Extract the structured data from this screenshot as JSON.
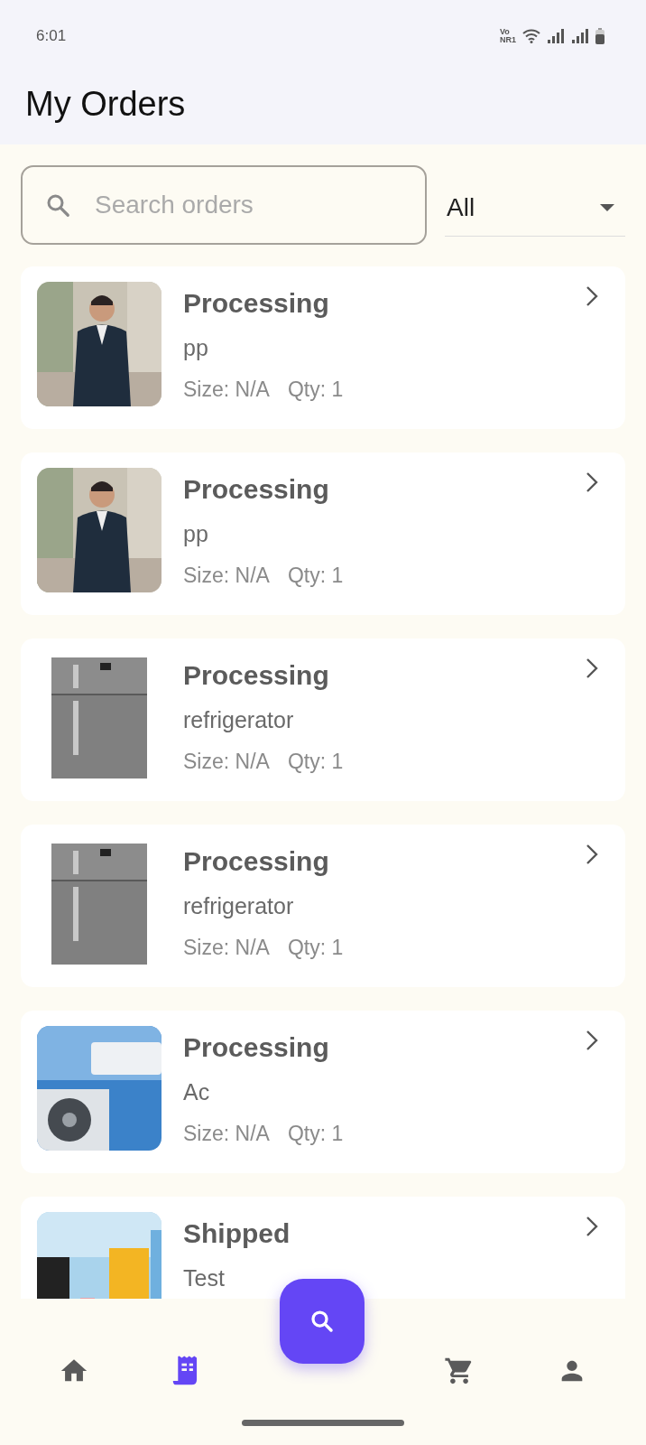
{
  "status_bar": {
    "time": "6:01",
    "network_top": "Vo",
    "network_bottom": "NR1"
  },
  "header": {
    "title": "My Orders"
  },
  "search": {
    "placeholder": "Search orders"
  },
  "filter": {
    "value": "All"
  },
  "orders": [
    {
      "kind": "picture",
      "status": "Processing",
      "name": "pp",
      "size": "Size: N/A",
      "qty": "Qty: 1"
    },
    {
      "kind": "picture",
      "status": "Processing",
      "name": "pp",
      "size": "Size: N/A",
      "qty": "Qty: 1"
    },
    {
      "kind": "picture",
      "status": "Processing",
      "name": "refrigerator",
      "size": "Size: N/A",
      "qty": "Qty: 1"
    },
    {
      "kind": "picture",
      "status": "Processing",
      "name": "refrigerator",
      "size": "Size: N/A",
      "qty": "Qty: 1"
    },
    {
      "kind": "picture",
      "status": "Processing",
      "name": "Ac",
      "size": "Size: N/A",
      "qty": "Qty: 1"
    },
    {
      "kind": "picture",
      "status": "Shipped",
      "name": "Test"
    }
  ],
  "bottom_nav": [
    {
      "kind": "home",
      "selected": false
    },
    {
      "kind": "orders",
      "selected": true
    },
    {
      "kind": "search",
      "selected": false
    },
    {
      "kind": "cart",
      "selected": false
    },
    {
      "kind": "profile",
      "selected": false
    }
  ]
}
